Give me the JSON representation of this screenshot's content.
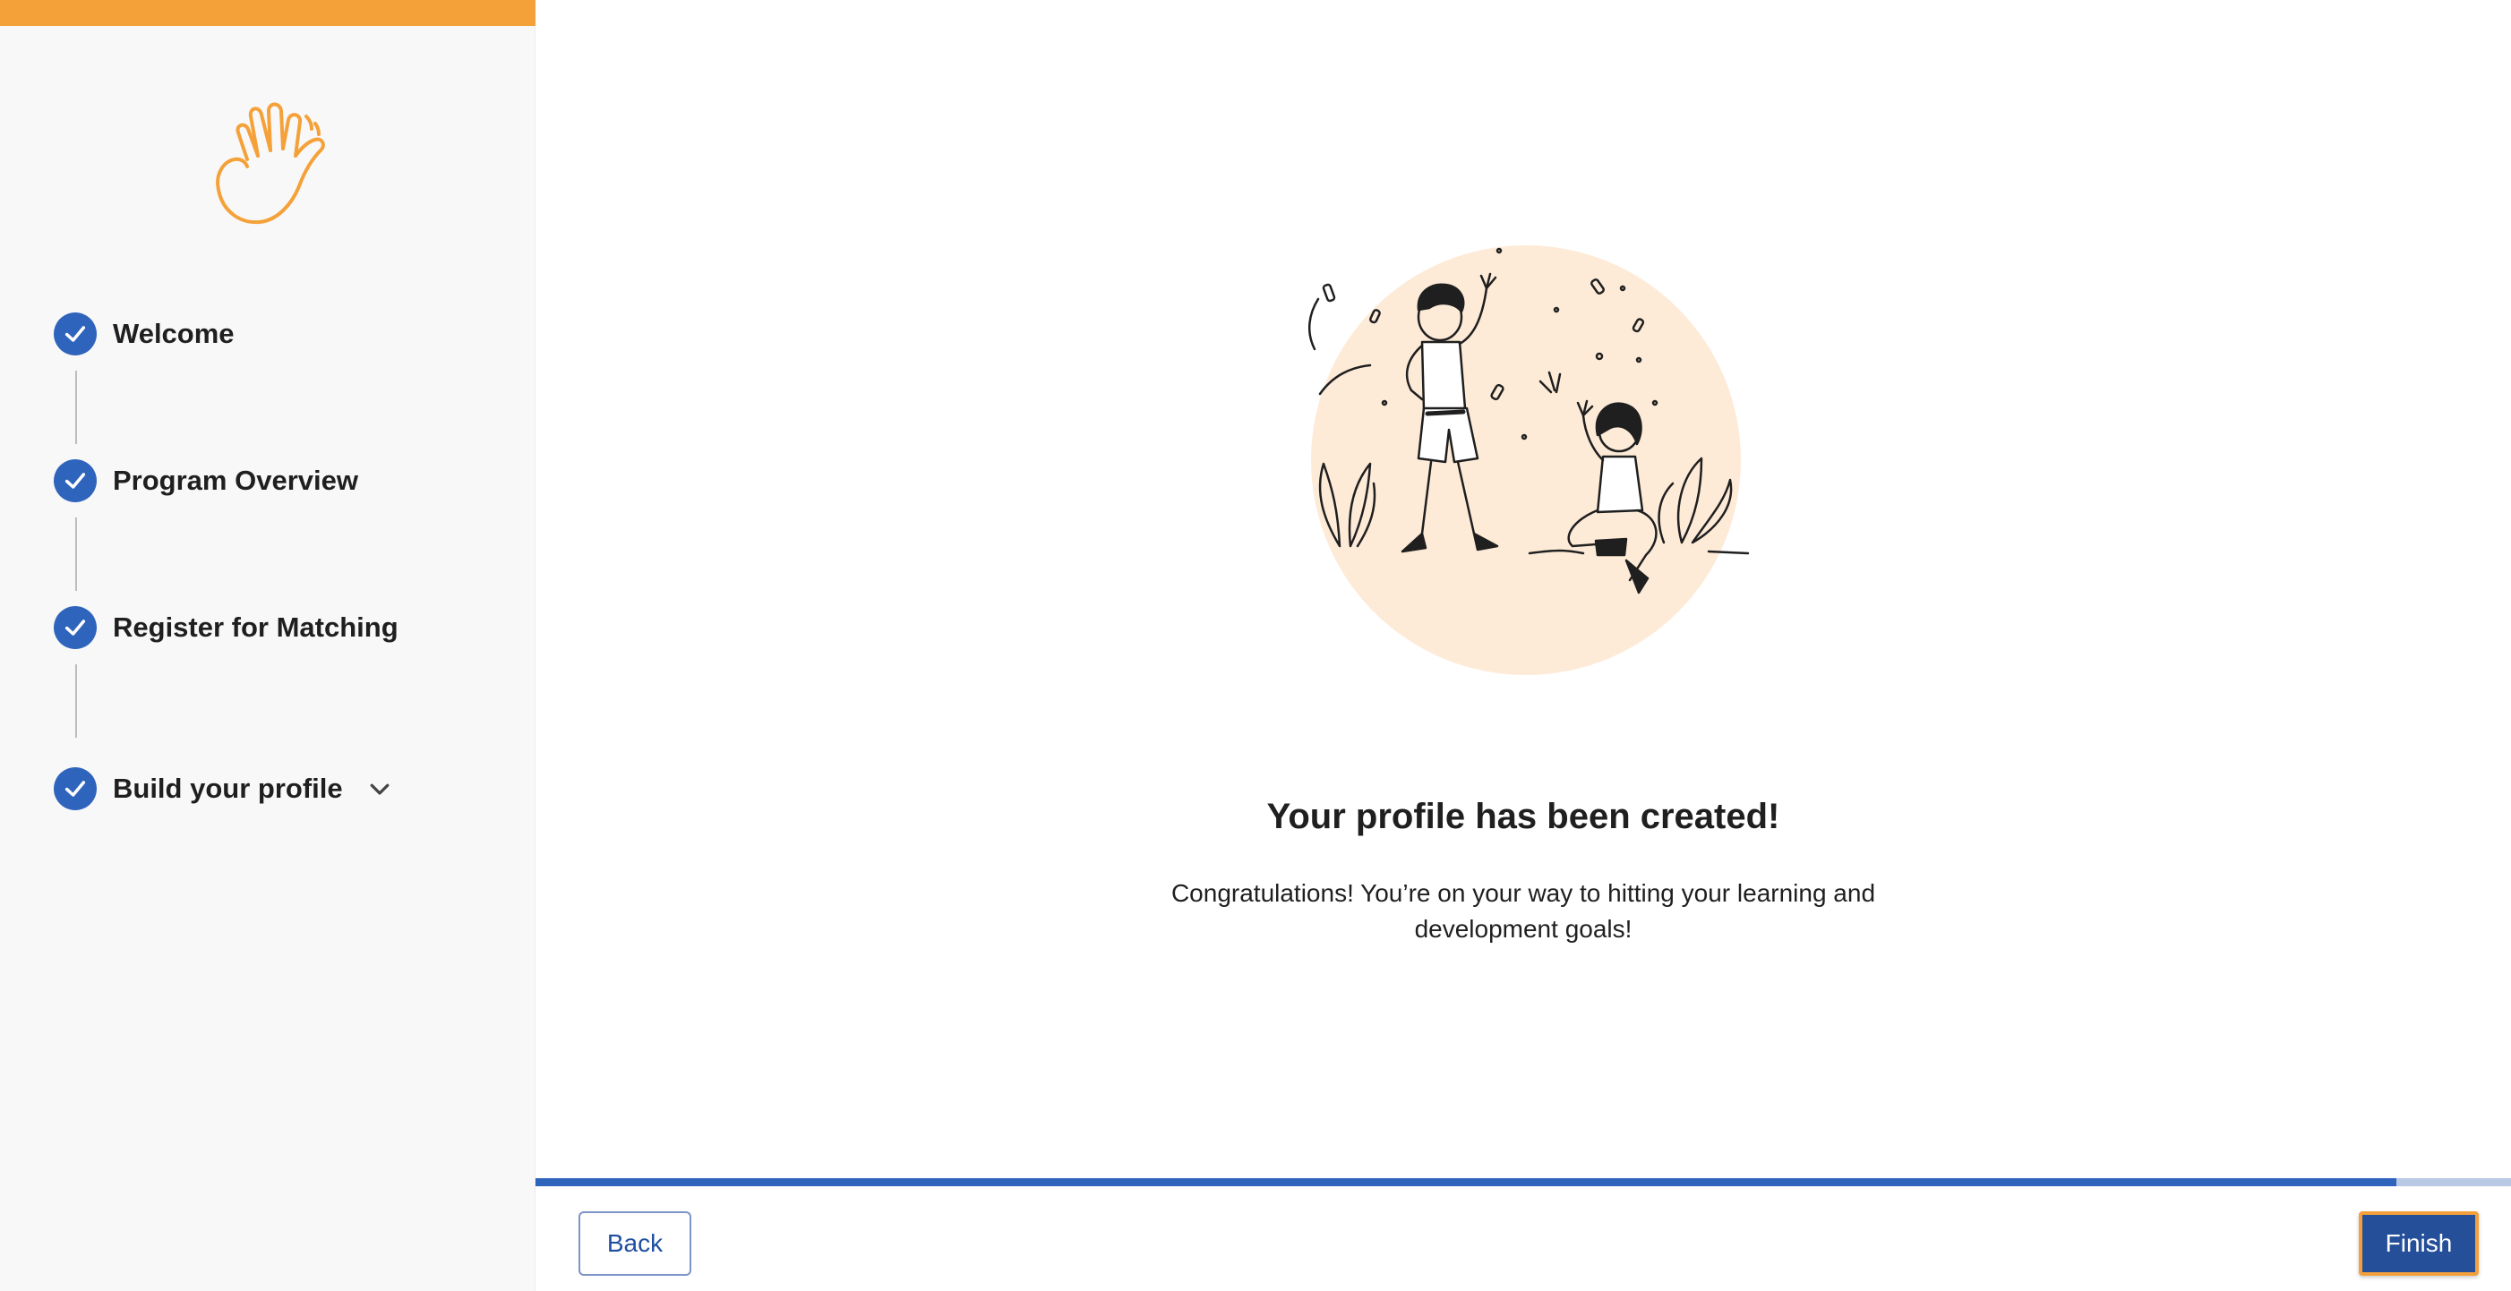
{
  "sidebar": {
    "logo_icon": "waving-hand-icon",
    "accent_color": "#f5a13a",
    "steps": [
      {
        "label": "Welcome",
        "status": "complete"
      },
      {
        "label": "Program Overview",
        "status": "complete"
      },
      {
        "label": "Register for Matching",
        "status": "complete"
      },
      {
        "label": "Build your profile",
        "status": "complete",
        "expandable": true
      }
    ]
  },
  "main": {
    "illustration": "celebrating-people-illustration",
    "headline": "Your profile has been created!",
    "subtext": "Congratulations! You’re on your way to hitting your learning and development goals!",
    "progress": 0.942
  },
  "footer": {
    "back_label": "Back",
    "finish_label": "Finish"
  },
  "colors": {
    "primary": "#2f64bd",
    "button_dark": "#254f99",
    "focus_ring": "#f3a03c",
    "illustration_bg": "#fdebd8"
  }
}
